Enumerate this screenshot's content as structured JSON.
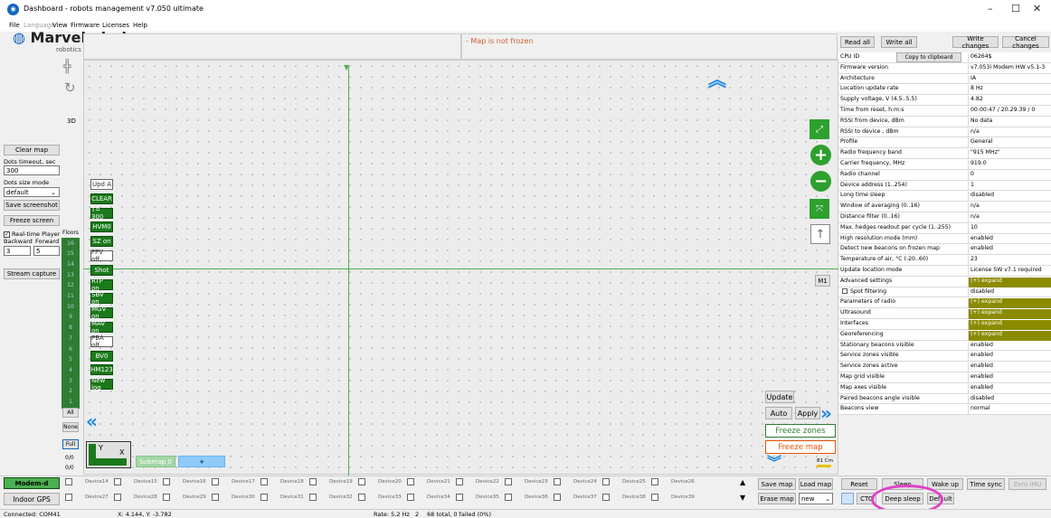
{
  "window": {
    "title": "Dashboard - robots management  v7.050  ultimate",
    "minimize": "–",
    "maximize": "☐",
    "close": "✕"
  },
  "menu": [
    "File",
    "Language",
    "View",
    "Firmware",
    "Licenses",
    "Help"
  ],
  "logo": {
    "name": "Marvelmind",
    "sub": "robotics"
  },
  "left": {
    "clear_map": "Clear map",
    "dots_timeout_label": "Dots timeout, sec",
    "dots_timeout_value": "300",
    "dots_size_label": "Dots size mode",
    "dots_size_value": "default",
    "save_screenshot": "Save screenshot",
    "freeze_screen": "Freeze screen",
    "realtime_player": "Real-time Player",
    "backward": "Backward",
    "forward": "Forward",
    "backward_val": "3",
    "forward_val": "5",
    "stream_capture": "Stream capture",
    "tool_3d": "3D"
  },
  "floors": {
    "label": "Floors",
    "items": [
      "16",
      "15",
      "14",
      "13",
      "12",
      "11",
      "10",
      "9",
      "8",
      "7",
      "6",
      "5",
      "4",
      "3",
      "2",
      "1"
    ],
    "all": "All",
    "none": "None",
    "full": "Full",
    "zero1": "0/0",
    "zero2": "0/0"
  },
  "map_buttons": [
    {
      "label": "Upd A",
      "style": "white"
    },
    {
      "label": "CLEAR",
      "style": "green"
    },
    {
      "label": "T= 300",
      "style": "green"
    },
    {
      "label": "HVM0",
      "style": "green"
    },
    {
      "label": "SZ on",
      "style": "green"
    },
    {
      "label": "FPV off",
      "style": "white"
    },
    {
      "label": "Shot",
      "style": "green"
    },
    {
      "label": "RTP on",
      "style": "green"
    },
    {
      "label": "SBV on",
      "style": "green"
    },
    {
      "label": "MGV on",
      "style": "green"
    },
    {
      "label": "MAV on",
      "style": "green"
    },
    {
      "label": "PBA off",
      "style": "white"
    },
    {
      "label": "BV0",
      "style": "green"
    },
    {
      "label": "HM123",
      "style": "green"
    },
    {
      "label": "New log",
      "style": "green"
    }
  ],
  "map": {
    "frozen_text": "- Map is not frozen",
    "m1": "M1",
    "update": "Update",
    "auto": "Auto",
    "apply": "Apply",
    "freeze_zones": "Freeze zones",
    "freeze_map": "Freeze map",
    "scale": "81 Cm",
    "submap": "Submap 0",
    "plus": "+",
    "axis_y": "Y",
    "axis_x": "X"
  },
  "right": {
    "read_all": "Read all",
    "write_all": "Write all",
    "write_changes": "Write changes",
    "cancel_changes": "Cancel changes",
    "copy_clipboard": "Copy to clipboard",
    "rows": [
      {
        "k": "CPU ID",
        "v": "06264$"
      },
      {
        "k": "Firmware version",
        "v": "v7.053i Modem HW v5.1-3"
      },
      {
        "k": "Architecture",
        "v": "IA"
      },
      {
        "k": "Location update rate",
        "v": "8 Hz"
      },
      {
        "k": "Supply voltage, V (4.5..5.5)",
        "v": "4.82"
      },
      {
        "k": "Time from reset, h:m:s",
        "v": "00:00:47 / 20.29.39 / 0"
      },
      {
        "k": "RSSI from device, dBm",
        "v": "No data"
      },
      {
        "k": "RSSI to device , dBm",
        "v": "n/a"
      },
      {
        "k": "Profile",
        "v": "General"
      },
      {
        "k": "Radio frequency band",
        "v": "\"915 MHz\""
      },
      {
        "k": "Carrier frequency, MHz",
        "v": "919.0"
      },
      {
        "k": "Radio channel",
        "v": "0"
      },
      {
        "k": "Device address (1..254)",
        "v": "1"
      },
      {
        "k": "Long time sleep",
        "v": "disabled"
      },
      {
        "k": "Window of averaging (0..16)",
        "v": "n/a"
      },
      {
        "k": "Distance filter (0..16)",
        "v": "n/a"
      },
      {
        "k": "Max. hedges readout per cycle (1..255)",
        "v": "10"
      },
      {
        "k": "High resolution mode (mm)",
        "v": "enabled"
      },
      {
        "k": "Detect new beacons on frozen map",
        "v": "enabled"
      },
      {
        "k": "Temperature of air, °C (-20..60)",
        "v": "23"
      },
      {
        "k": "Update location mode",
        "v": "License SW v7.1 required"
      },
      {
        "k": "Advanced settings",
        "v": "(+) expand",
        "exp": true
      },
      {
        "k": "Spot filtering",
        "v": "disabled",
        "cb": true
      },
      {
        "k": "Parameters of radio",
        "v": "(+) expand",
        "exp": true
      },
      {
        "k": "Ultrasound",
        "v": "(+) expand",
        "exp": true
      },
      {
        "k": "Interfaces",
        "v": "(+) expand",
        "exp": true
      },
      {
        "k": "Georeferencing",
        "v": "(+) expand",
        "exp": true
      },
      {
        "k": "Stationary beacons visible",
        "v": "enabled"
      },
      {
        "k": "Service zones visible",
        "v": "enabled"
      },
      {
        "k": "Service zones active",
        "v": "enabled"
      },
      {
        "k": "Map grid visible",
        "v": "enabled"
      },
      {
        "k": "Map axes visible",
        "v": "enabled"
      },
      {
        "k": "Paired beacons angle visible",
        "v": "disabled"
      },
      {
        "k": "Beacons view",
        "v": "normal"
      }
    ]
  },
  "bottom": {
    "modem": "Modem-d",
    "indoor_gps": "Indoor GPS",
    "devices_row1": [
      "Device14",
      "Device15",
      "Device16",
      "Device17",
      "Device18",
      "Device19",
      "Device20",
      "Device21",
      "Device22",
      "Device23",
      "Device24",
      "Device25",
      "Device26"
    ],
    "devices_row2": [
      "Device27",
      "Device28",
      "Device29",
      "Device30",
      "Device31",
      "Device32",
      "Device33",
      "Device34",
      "Device35",
      "Device36",
      "Device37",
      "Device38",
      "Device39"
    ],
    "save_map": "Save map",
    "load_map": "Load map",
    "erase_map": "Erase map",
    "new_select": "new",
    "reset": "Reset",
    "sleep": "Sleep",
    "wake_up": "Wake up",
    "time_sync": "Time sync",
    "zero_imu": "Zero IMU",
    "ctc": "CTC",
    "deep_sleep": "Deep sleep",
    "default": "Default"
  },
  "status": {
    "port": "Connected: COM41",
    "coords": "X: 4.144, Y: -3.782",
    "rate": "Rate: 5.2 Hz",
    "count": "2",
    "total": "68 total, 0 failed (0%)"
  },
  "colors": {
    "accent_green": "#2ea02e",
    "expand_olive": "#8b8b00",
    "frozen_orange": "#d06030",
    "highlight_circle": "#e040c8"
  }
}
